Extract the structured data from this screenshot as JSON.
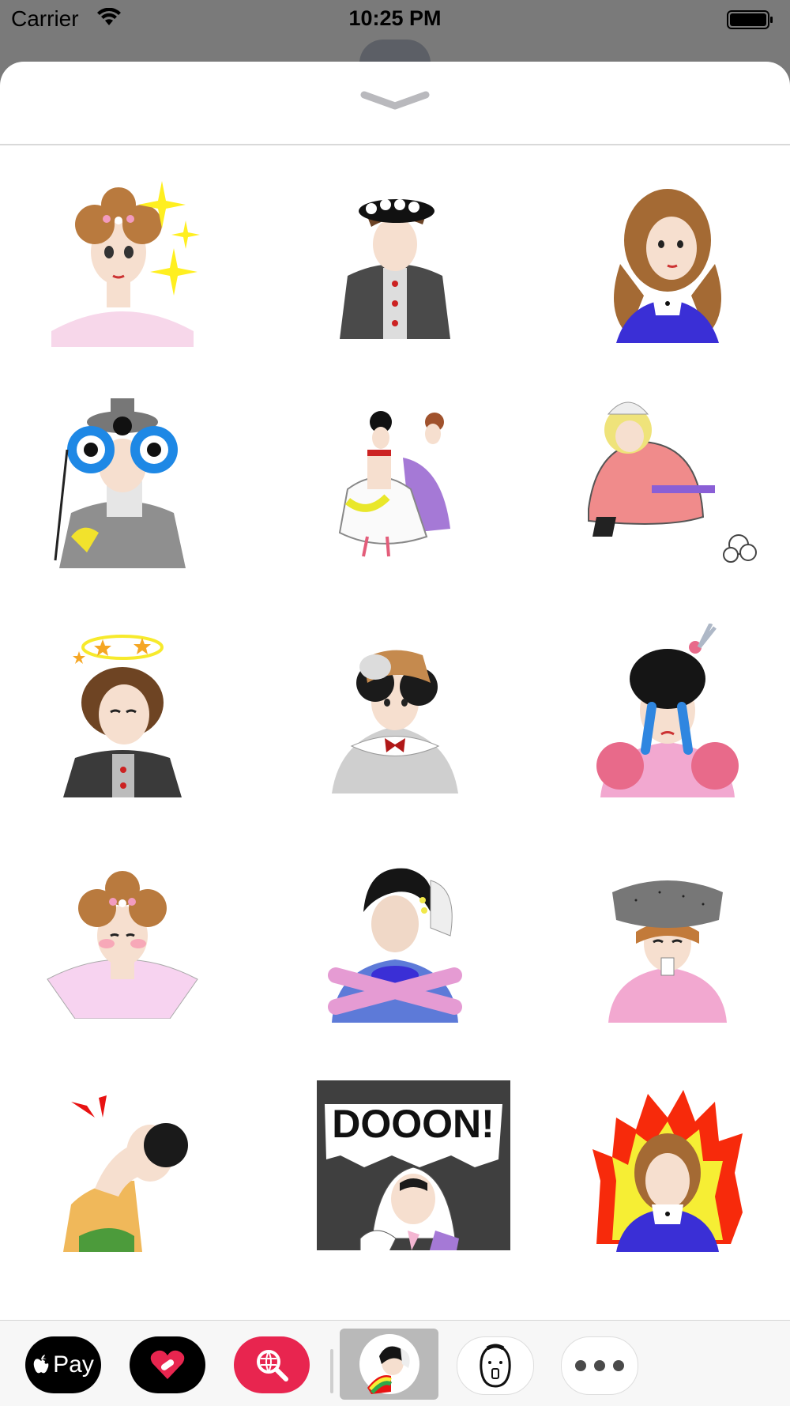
{
  "status_bar": {
    "carrier": "Carrier",
    "time": "10:25 PM"
  },
  "sheet": {
    "collapse_icon": "chevron-down-icon",
    "stickers": [
      {
        "name": "sticker-sparkle-lady"
      },
      {
        "name": "sticker-flower-hat-lady"
      },
      {
        "name": "sticker-curly-hair-blue-dress"
      },
      {
        "name": "sticker-big-eye-mask-lady"
      },
      {
        "name": "sticker-two-ladies-walking"
      },
      {
        "name": "sticker-sitting-pink-lady"
      },
      {
        "name": "sticker-dizzy-stars-lady"
      },
      {
        "name": "sticker-bonnet-red-bow-lady"
      },
      {
        "name": "sticker-crying-pink-lady"
      },
      {
        "name": "sticker-blushing-pink-lady"
      },
      {
        "name": "sticker-crossed-arms-lady"
      },
      {
        "name": "sticker-grey-hat-lady"
      },
      {
        "name": "sticker-shocked-lady"
      },
      {
        "name": "sticker-dooon-lady",
        "text": "DOOON!"
      },
      {
        "name": "sticker-fire-lady"
      }
    ]
  },
  "drawer": {
    "apple_pay_label": "Pay",
    "apps": [
      "apple-pay",
      "heart-app",
      "search-gif-app",
      "ladies-sticker-app",
      "egg-face-app",
      "more-apps"
    ]
  },
  "colors": {
    "accent_pink": "#e8254f",
    "dress_blue": "#3a2fd6"
  }
}
